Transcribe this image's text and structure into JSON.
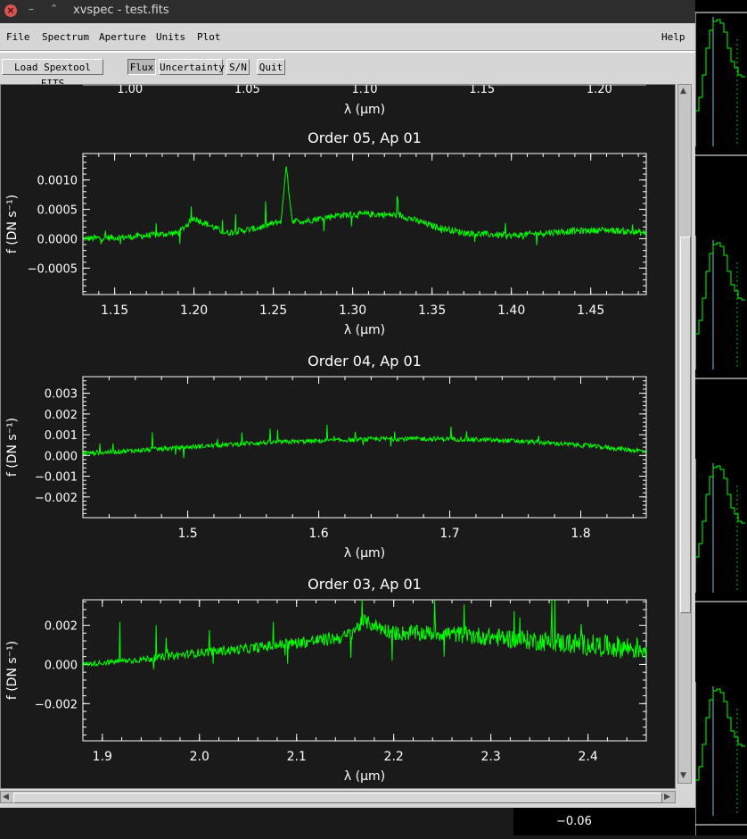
{
  "window": {
    "title": "xvspec - test.fits",
    "close_glyph": "×",
    "min_glyph": "–",
    "max_glyph": "⌃"
  },
  "menu": {
    "items": [
      "File",
      "Spectrum",
      "Aperture",
      "Units",
      "Plot"
    ],
    "help": "Help"
  },
  "toolbar": {
    "load": "Load Spextool FITS",
    "flux": "Flux",
    "uncertainty": "Uncertainty",
    "sn": "S/N",
    "quit": "Quit"
  },
  "bottom_label": "−0.06",
  "chart_data": [
    {
      "type": "line",
      "title": "",
      "partial": true,
      "xlabel": "λ (μm)",
      "xticks": [
        "1.00",
        "1.05",
        "1.10",
        "1.15",
        "1.20"
      ],
      "xlim": [
        0.98,
        1.22
      ]
    },
    {
      "type": "line",
      "title": "Order 05, Ap 01",
      "xlabel": "λ (μm)",
      "ylabel": "f (DN s⁻¹)",
      "xlim": [
        1.13,
        1.485
      ],
      "ylim": [
        -0.00095,
        0.00145
      ],
      "xticks": [
        "1.15",
        "1.20",
        "1.25",
        "1.30",
        "1.35",
        "1.40",
        "1.45"
      ],
      "xtick_values": [
        1.15,
        1.2,
        1.25,
        1.3,
        1.35,
        1.4,
        1.45
      ],
      "yticks": [
        "−0.0005",
        "0.0000",
        "0.0005",
        "0.0010"
      ],
      "ytick_values": [
        -0.0005,
        0.0,
        0.0005,
        0.001
      ],
      "color": "#00ff00",
      "series": [
        {
          "x": [
            1.13,
            1.16,
            1.19,
            1.2,
            1.22,
            1.24,
            1.255,
            1.258,
            1.262,
            1.27,
            1.29,
            1.31,
            1.33,
            1.35,
            1.37,
            1.4,
            1.43,
            1.46,
            1.485
          ],
          "y": [
            0.0,
            3e-05,
            0.0001,
            0.00035,
            0.0001,
            0.00018,
            0.0003,
            0.00125,
            0.0003,
            0.0003,
            0.0004,
            0.00042,
            0.0004,
            0.00022,
            0.0001,
            5e-05,
            0.00012,
            0.00015,
            0.0001
          ]
        }
      ]
    },
    {
      "type": "line",
      "title": "Order 04, Ap 01",
      "xlabel": "λ (μm)",
      "ylabel": "f (DN s⁻¹)",
      "xlim": [
        1.42,
        1.85
      ],
      "ylim": [
        -0.003,
        0.0038
      ],
      "xticks": [
        "1.5",
        "1.6",
        "1.7",
        "1.8"
      ],
      "xtick_values": [
        1.5,
        1.6,
        1.7,
        1.8
      ],
      "yticks": [
        "−0.002",
        "−0.001",
        "0.000",
        "0.001",
        "0.002",
        "0.003"
      ],
      "ytick_values": [
        -0.002,
        -0.001,
        0.0,
        0.001,
        0.002,
        0.003
      ],
      "color": "#00ff00",
      "series": [
        {
          "x": [
            1.42,
            1.45,
            1.5,
            1.55,
            1.6,
            1.65,
            1.7,
            1.75,
            1.8,
            1.85
          ],
          "y": [
            0.0001,
            0.0002,
            0.0004,
            0.0006,
            0.0007,
            0.0008,
            0.0008,
            0.0007,
            0.0005,
            0.0002
          ]
        }
      ]
    },
    {
      "type": "line",
      "title": "Order 03, Ap 01",
      "xlabel": "λ (μm)",
      "ylabel": "f (DN s⁻¹)",
      "xlim": [
        1.88,
        2.46
      ],
      "ylim": [
        -0.0039,
        0.0033
      ],
      "xticks": [
        "1.9",
        "2.0",
        "2.1",
        "2.2",
        "2.3",
        "2.4"
      ],
      "xtick_values": [
        1.9,
        2.0,
        2.1,
        2.2,
        2.3,
        2.4
      ],
      "yticks": [
        "−0.002",
        "0.000",
        "0.002"
      ],
      "ytick_values": [
        -0.002,
        0.0,
        0.002
      ],
      "color": "#00ff00",
      "series": [
        {
          "x": [
            1.88,
            1.95,
            2.0,
            2.05,
            2.1,
            2.15,
            2.17,
            2.2,
            2.25,
            2.3,
            2.35,
            2.4,
            2.46
          ],
          "y": [
            0.0,
            0.0003,
            0.0006,
            0.0008,
            0.0011,
            0.0014,
            0.0022,
            0.0016,
            0.0016,
            0.0014,
            0.0012,
            0.001,
            0.0008
          ]
        }
      ]
    }
  ]
}
